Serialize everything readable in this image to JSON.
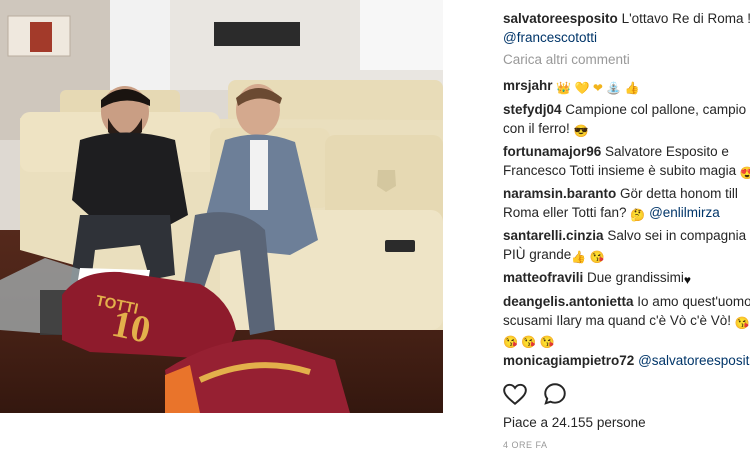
{
  "post": {
    "author": "salvatoreesposito",
    "caption_text": "L'ottavo Re di Roma !!",
    "caption_mention": "@francescototti",
    "load_more": "Carica altri commenti"
  },
  "comments": [
    {
      "user": "mrsjahr",
      "text": "",
      "emoji": "👑 💛 ❤ ⛲ 👍"
    },
    {
      "user": "stefydj04",
      "text": "Campione col pallone, campio",
      "text2": "con il ferro!",
      "emoji": "😎"
    },
    {
      "user": "fortunamajor96",
      "text": "Salvatore Esposito e",
      "text2": "Francesco Totti insieme è subito magia",
      "emoji": "😍"
    },
    {
      "user": "naramsin.baranto",
      "text": "Gör detta honom till",
      "text2": "Roma eller Totti fan?",
      "emoji": "🤔",
      "mention": "@enlilmirza"
    },
    {
      "user": "santarelli.cinzia",
      "text": "Salvo sei in compagnia c",
      "text2": "PIÙ grande",
      "emoji": "👍 😘"
    },
    {
      "user": "matteofravili",
      "text": "Due grandissimi",
      "emoji": "♥"
    },
    {
      "user": "deangelis.antonietta",
      "text": "Io amo quest'uomo",
      "text2": "scusami Ilary ma quand c'è Vò c'è Vò!",
      "emoji": "😘",
      "emoji_row": "😘 😘 😘"
    },
    {
      "user": "monicagiampietro72",
      "mention": "@salvatoreesposit"
    }
  ],
  "icons": {
    "like": "heart-icon",
    "comment": "comment-bubble-icon"
  },
  "likes_text": "Piace a 24.155 persone",
  "timestamp": "4 ORE FA",
  "photo": {
    "jersey_text": "TOTTI",
    "jersey_number": "10",
    "colors": {
      "jersey": "#8e1b2c",
      "gold": "#e3b04b",
      "sofa": "#eadfbe",
      "floor": "#4a2318"
    }
  }
}
